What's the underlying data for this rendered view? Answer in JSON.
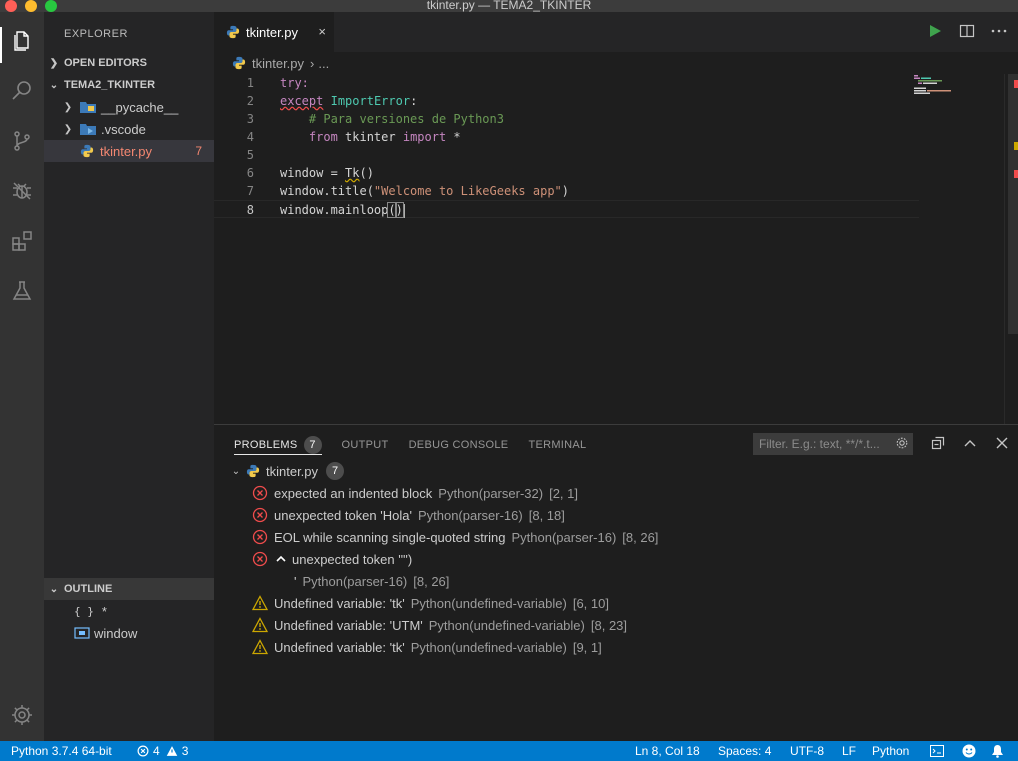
{
  "window": {
    "title": "tkinter.py — TEMA2_TKINTER"
  },
  "activity_bar": {
    "items": [
      "explorer-icon",
      "search-icon",
      "source-control-icon",
      "debug-icon",
      "extensions-icon",
      "testing-flask-icon"
    ],
    "bottom": "settings-gear-icon"
  },
  "sidebar": {
    "title": "EXPLORER",
    "open_editors": "OPEN EDITORS",
    "workspace": "TEMA2_TKINTER",
    "tree": [
      {
        "label": "__pycache__",
        "type": "folder"
      },
      {
        "label": ".vscode",
        "type": "folder"
      },
      {
        "label": "tkinter.py",
        "type": "file",
        "problems": "7"
      }
    ],
    "outline_title": "OUTLINE",
    "outline": [
      {
        "icon": "{ }",
        "label": "*"
      },
      {
        "icon": "window",
        "label": "window"
      }
    ]
  },
  "editor": {
    "tab_label": "tkinter.py",
    "tab_close": "×",
    "breadcrumb_file": "tkinter.py",
    "breadcrumb_rest": "...",
    "line_numbers": [
      "1",
      "2",
      "3",
      "4",
      "5",
      "6",
      "7",
      "8"
    ],
    "code": {
      "l1_try": "try:",
      "l2_except": "except",
      "l2_class": "ImportError",
      "l2_colon": ":",
      "l3_comment": "# Para versiones de Python3",
      "l4_from": "from",
      "l4_module": " tkinter ",
      "l4_import": "import",
      "l4_star": " *",
      "l6_a": "window = ",
      "l6_b": "Tk",
      "l6_c": "()",
      "l7_a": "window.title(",
      "l7_b": "\"Welcome to LikeGeeks app\"",
      "l7_c": ")",
      "l8_a": "window.mainloop",
      "l8_b": "(",
      "l8_c": ")"
    }
  },
  "panel": {
    "tabs": [
      {
        "label": "PROBLEMS",
        "badge": "7"
      },
      {
        "label": "OUTPUT"
      },
      {
        "label": "DEBUG CONSOLE"
      },
      {
        "label": "TERMINAL"
      }
    ],
    "filter_placeholder": "Filter. E.g.: text, **/*.t...",
    "file": {
      "label": "tkinter.py",
      "count": "7"
    },
    "problems": [
      {
        "severity": "error",
        "message": "expected an indented block",
        "source": "Python(parser-32)",
        "pos": "[2, 1]"
      },
      {
        "severity": "error",
        "message": "unexpected token 'Hola'",
        "source": "Python(parser-16)",
        "pos": "[8, 18]"
      },
      {
        "severity": "error",
        "message": "EOL while scanning single-quoted string",
        "source": "Python(parser-16)",
        "pos": "[8, 26]"
      },
      {
        "severity": "error",
        "message": "unexpected token '\"')",
        "source": "",
        "pos": ""
      },
      {
        "severity": "none",
        "message": "'",
        "source": "Python(parser-16)",
        "pos": "[8, 26]"
      },
      {
        "severity": "warning",
        "message": "Undefined variable: 'tk'",
        "source": "Python(undefined-variable)",
        "pos": "[6, 10]"
      },
      {
        "severity": "warning",
        "message": "Undefined variable: 'UTM'",
        "source": "Python(undefined-variable)",
        "pos": "[8, 23]"
      },
      {
        "severity": "warning",
        "message": "Undefined variable: 'tk'",
        "source": "Python(undefined-variable)",
        "pos": "[9, 1]"
      }
    ]
  },
  "statusbar": {
    "interpreter": "Python 3.7.4 64-bit",
    "errors": "4",
    "warnings": "3",
    "position": "Ln 8, Col 18",
    "spaces": "Spaces: 4",
    "encoding": "UTF-8",
    "eol": "LF",
    "language": "Python"
  },
  "colors": {
    "accent": "#007acc",
    "error": "#f14c4c",
    "warning": "#cca700",
    "error_count": "#f48771"
  }
}
